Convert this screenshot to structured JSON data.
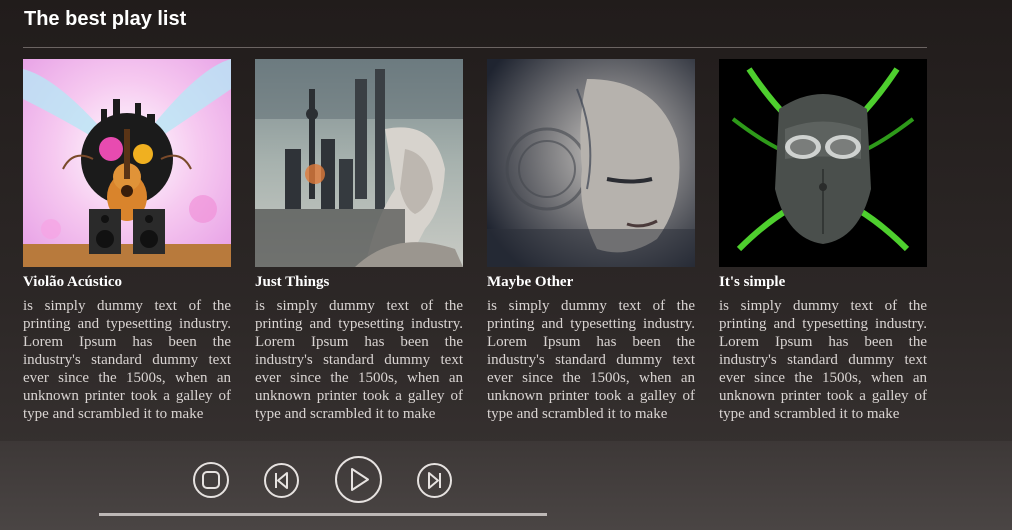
{
  "header": {
    "title": "The best play list"
  },
  "cards": [
    {
      "title": "Violão Acústico",
      "description": "is simply dummy text of the printing and typesetting industry. Lorem Ipsum has been the industry's standard dummy text ever since the 1500s, when an unknown printer took a galley of type and scrambled it to make",
      "art_icon": "guitar-city-art"
    },
    {
      "title": "Just Things",
      "description": "is simply dummy text of the printing and typesetting industry. Lorem Ipsum has been the industry's standard dummy text ever since the 1500s, when an unknown printer took a galley of type and scrambled it to make",
      "art_icon": "woman-city-art"
    },
    {
      "title": "Maybe Other",
      "description": "is simply dummy text of the printing and typesetting industry. Lorem Ipsum has been the industry's standard dummy text ever since the 1500s, when an unknown printer took a galley of type and scrambled it to make",
      "art_icon": "face-texture-art"
    },
    {
      "title": "It's simple",
      "description": "is simply dummy text of the printing and typesetting industry. Lorem Ipsum has been the industry's standard dummy text ever since the 1500s, when an unknown printer took a galley of type and scrambled it to make",
      "art_icon": "mask-art"
    }
  ],
  "player": {
    "controls": [
      "stop-icon",
      "skip-back-icon",
      "play-icon",
      "skip-forward-icon"
    ],
    "progress": 1.0
  },
  "colors": {
    "background": "#211c1b",
    "player_bar": "#4a4544",
    "control_stroke": "#e6e2e0",
    "title_text": "#ffffff"
  }
}
